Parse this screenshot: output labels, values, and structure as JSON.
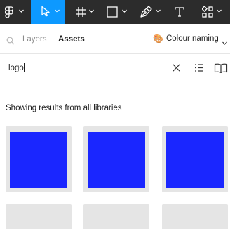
{
  "toolbar": {
    "tools": [
      {
        "name": "figma-menu",
        "icon": "figma-logo-icon",
        "active": false
      },
      {
        "name": "move",
        "icon": "cursor-arrow-icon",
        "active": true
      },
      {
        "name": "frame",
        "icon": "frame-hash-icon",
        "active": false
      },
      {
        "name": "shape",
        "icon": "rectangle-icon",
        "active": false
      },
      {
        "name": "pen",
        "icon": "pen-nib-icon",
        "active": false
      },
      {
        "name": "text",
        "icon": "text-t-icon",
        "active": false
      },
      {
        "name": "resources",
        "icon": "components-grid-icon",
        "active": false
      }
    ],
    "background": "#2c2c2c",
    "accent": "#0d99ff"
  },
  "tabs": {
    "layers_label": "Layers",
    "assets_label": "Assets",
    "active": "Assets"
  },
  "library": {
    "emoji": "🎨",
    "label": "Colour naming"
  },
  "search": {
    "value": "logo",
    "clear_icon": "close-icon",
    "list_view_icon": "list-view-icon",
    "library_icon": "book-icon"
  },
  "results": {
    "label": "Showing results from all libraries",
    "tiles": [
      {
        "swatch_color": "#1a26ff"
      },
      {
        "swatch_color": "#1a26ff"
      },
      {
        "swatch_color": "#1a26ff"
      },
      {
        "swatch_color": null
      },
      {
        "swatch_color": null
      },
      {
        "swatch_color": null
      }
    ],
    "tile_background": "#e5e5e5"
  }
}
